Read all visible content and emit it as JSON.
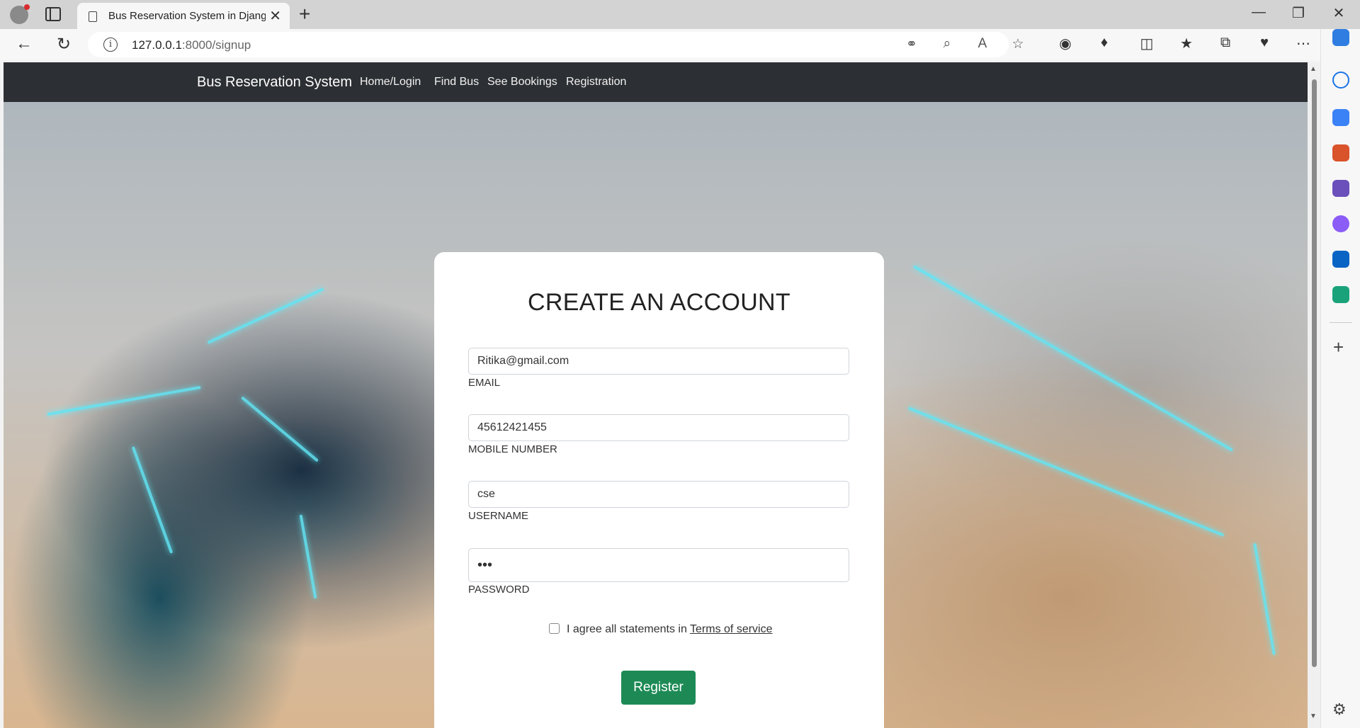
{
  "browser": {
    "tab_title": "Bus Reservation System in Djang",
    "url_host": "127.0.0.1",
    "url_rest": ":8000/signup",
    "tab_close": "✕",
    "new_tab": "+"
  },
  "navbar": {
    "brand": "Bus Reservation System",
    "links": [
      {
        "label": "Home/Login"
      },
      {
        "label": "Find Bus"
      },
      {
        "label": "See Bookings"
      },
      {
        "label": "Registration"
      }
    ]
  },
  "form": {
    "title": "CREATE AN ACCOUNT",
    "fields": [
      {
        "label": "EMAIL",
        "value": "Ritika@gmail.com"
      },
      {
        "label": "MOBILE NUMBER",
        "value": "45612421455"
      },
      {
        "label": "USERNAME",
        "value": "cse"
      },
      {
        "label": "PASSWORD",
        "value": "•••"
      }
    ],
    "agree_text": "I agree all statements in ",
    "terms_link": "Terms of service",
    "submit_label": "Register"
  },
  "icons": {
    "back": "back-arrow-icon",
    "refresh": "refresh-icon",
    "info": "info-icon",
    "key": "key-icon",
    "zoom": "zoom-out-icon",
    "read_aloud": "read-aloud-icon",
    "favorite": "star-icon",
    "extensions": "puzzle-icon",
    "settings": "gear-icon"
  },
  "colors": {
    "navbar_bg": "#2c2f33",
    "register_button": "#1d8a55"
  }
}
